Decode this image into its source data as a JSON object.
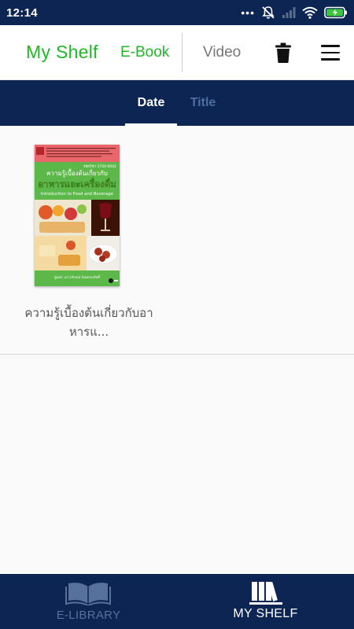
{
  "status_bar": {
    "time": "12:14",
    "more_indicator": "•••"
  },
  "header": {
    "title": "My Shelf",
    "tabs": [
      {
        "label": "E-Book",
        "active": true
      },
      {
        "label": "Video",
        "active": false
      }
    ],
    "actions": [
      "trash-icon",
      "menu-icon"
    ]
  },
  "sort_tabs": [
    {
      "label": "Date",
      "active": true
    },
    {
      "label": "Title",
      "active": false
    }
  ],
  "shelf": {
    "books": [
      {
        "title": "ความรู้เบื้องต้นเกี่ยวกับอาหารแ...",
        "cover": {
          "code": "รหัสวิชา 3700-0002",
          "title_line1": "ความรู้เบื้องต้นเกี่ยวกับ",
          "title_line2": "อาหารและเครื่องดื่ม",
          "title_en": "Introduction to Food and Beverage",
          "author": "ผู้แต่ง: เยาวลักษณ์ นันทประสิทธิ์"
        }
      }
    ]
  },
  "bottom_nav": [
    {
      "label": "E-LIBRARY",
      "icon": "open-book-icon",
      "active": false
    },
    {
      "label": "MY SHELF",
      "icon": "bookshelf-icon",
      "active": true
    }
  ],
  "colors": {
    "navy": "#0d2552",
    "accent_green": "#22b52a",
    "inactive_blue": "#56719c"
  }
}
